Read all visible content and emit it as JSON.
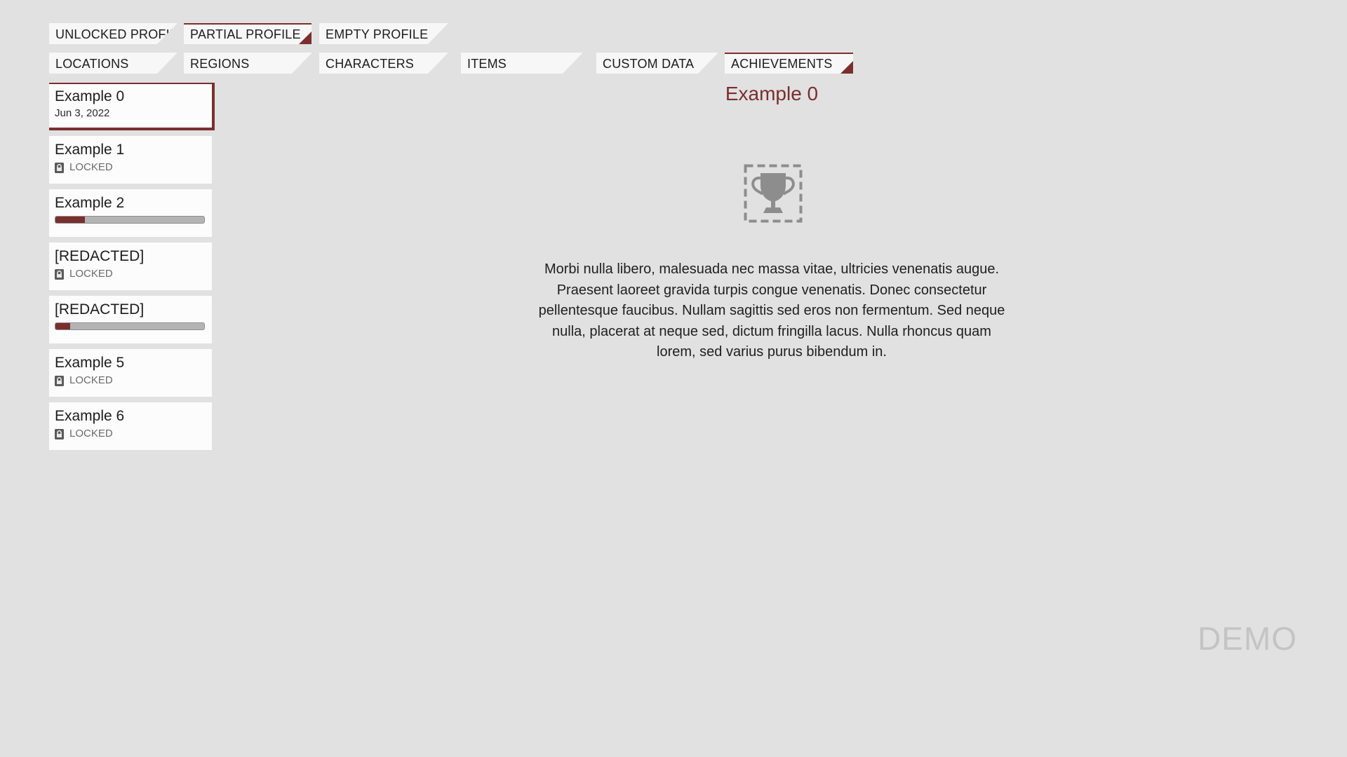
{
  "profile_tabs": [
    {
      "label": "UNLOCKED PROFILE",
      "active": false
    },
    {
      "label": "PARTIAL PROFILE",
      "active": true
    },
    {
      "label": "EMPTY PROFILE",
      "active": false
    }
  ],
  "category_tabs": [
    {
      "label": "LOCATIONS",
      "active": false
    },
    {
      "label": "REGIONS",
      "active": false
    },
    {
      "label": "CHARACTERS",
      "active": false
    },
    {
      "label": "ITEMS",
      "active": false
    },
    {
      "label": "CUSTOM DATA",
      "active": false
    },
    {
      "label": "ACHIEVEMENTS",
      "active": true
    }
  ],
  "achievements": [
    {
      "title": "Example 0",
      "date": "Jun 3, 2022",
      "state": "unlocked"
    },
    {
      "title": "Example 1",
      "status": "LOCKED",
      "state": "locked"
    },
    {
      "title": "Example 2",
      "progress": 0.2,
      "state": "progress"
    },
    {
      "title": "[REDACTED]",
      "status": "LOCKED",
      "state": "locked"
    },
    {
      "title": "[REDACTED]",
      "progress": 0.1,
      "state": "progress"
    },
    {
      "title": "Example 5",
      "status": "LOCKED",
      "state": "locked"
    },
    {
      "title": "Example 6",
      "status": "LOCKED",
      "state": "locked"
    }
  ],
  "detail": {
    "title": "Example 0",
    "icon": "trophy-icon",
    "description": "Morbi nulla libero, malesuada nec massa vitae, ultricies venenatis augue. Praesent laoreet gravida turpis congue venenatis. Donec consectetur pellentesque faucibus. Nullam sagittis sed eros non fermentum. Sed neque nulla, placerat at neque sed, dictum fringilla lacus. Nulla rhoncus quam lorem, sed varius purus bibendum in."
  },
  "watermark": "DEMO",
  "colors": {
    "accent": "#7b2e2e",
    "background": "#e1e1e1",
    "panel": "#fcfcfc"
  }
}
